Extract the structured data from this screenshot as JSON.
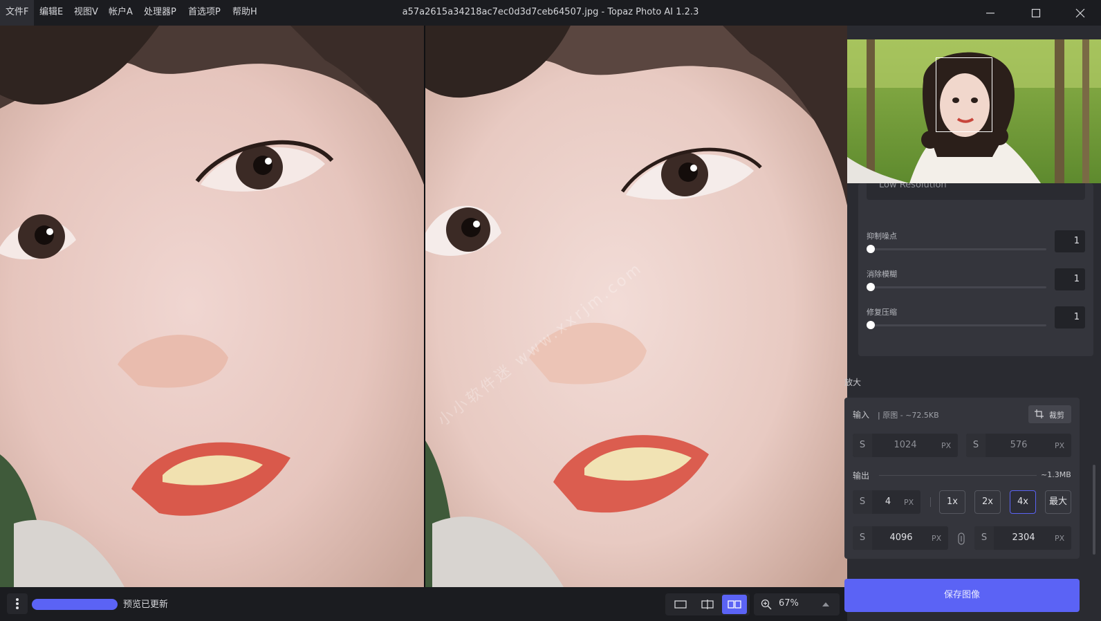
{
  "menu": {
    "items": [
      {
        "label": "文件F"
      },
      {
        "label": "编辑E"
      },
      {
        "label": "视图V"
      },
      {
        "label": "帐户A"
      },
      {
        "label": "处理器P"
      },
      {
        "label": "首选项P"
      },
      {
        "label": "帮助H"
      }
    ]
  },
  "window": {
    "title": "a57a2615a34218ac7ec0d3d7ceb64507.jpg - Topaz Photo AI 1.2.3"
  },
  "preview": {
    "watermark": "小小软件迷 www.xxrjm.com"
  },
  "bottom": {
    "status": "预览已更新",
    "zoom": "67%"
  },
  "panel": {
    "model_label": "Low Resolution",
    "sliders": [
      {
        "label": "抑制噪点",
        "value": "1"
      },
      {
        "label": "消除模糊",
        "value": "1"
      },
      {
        "label": "修复压缩",
        "value": "1"
      }
    ],
    "upscale": {
      "title": "放大",
      "input_label": "输入",
      "input_info": "| 原图 -  ~72.5KB",
      "crop_label": "裁剪",
      "input_width": "1024",
      "input_height": "576",
      "output_label": "输出",
      "output_size": "~1.3MB",
      "scale_value": "4",
      "scale_options": [
        "1x",
        "2x",
        "4x",
        "最大"
      ],
      "selected_scale": "4x",
      "output_width": "4096",
      "output_height": "2304",
      "prefix": "S",
      "unit": "PX"
    },
    "save_label": "保存图像"
  },
  "colors": {
    "accent": "#5b63f5",
    "background": "#1b1c20",
    "panel": "#2a2b31"
  }
}
